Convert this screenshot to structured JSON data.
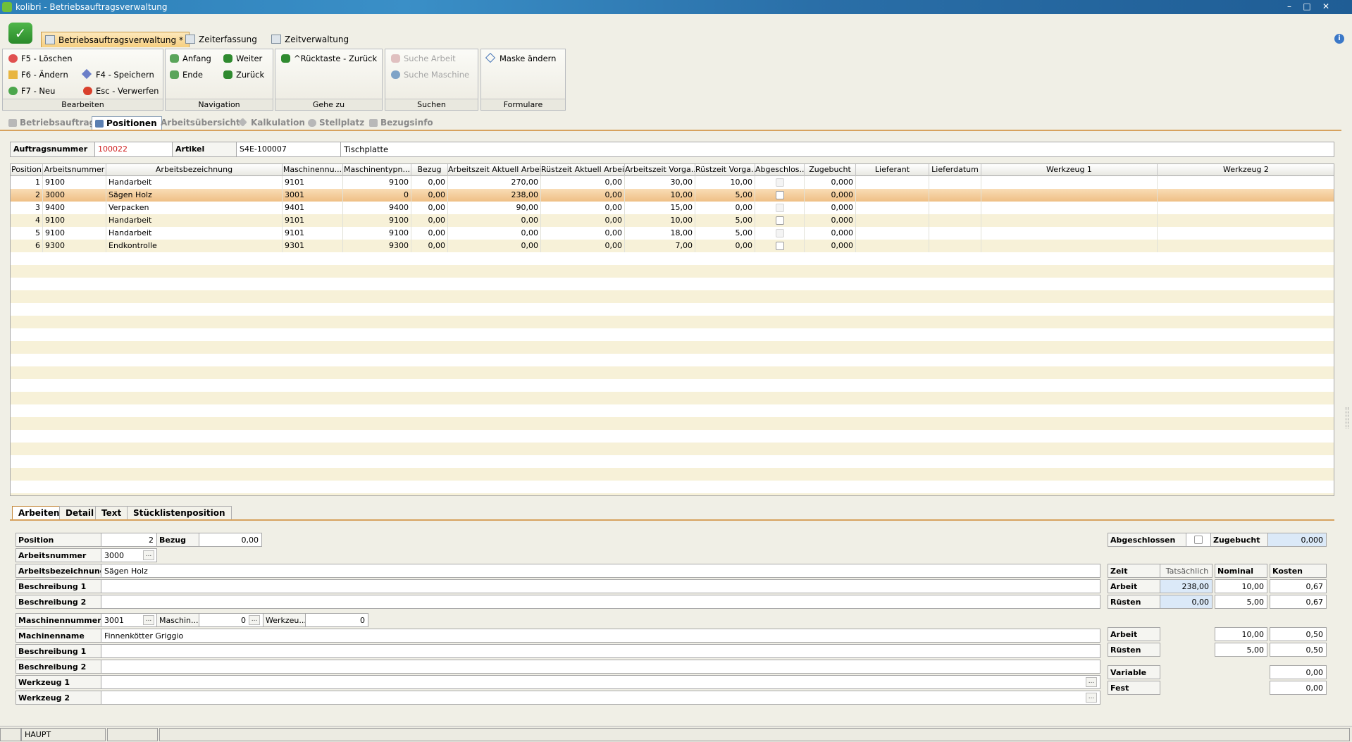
{
  "window": {
    "title": "kolibri - Betriebsauftragsverwaltung"
  },
  "ribbon_tabs": [
    "Betriebsauftragsverwaltung *",
    "Zeiterfassung",
    "Zeitverwaltung"
  ],
  "ribbon": {
    "bearbeiten": {
      "label": "Bearbeiten",
      "loeschen": "F5 - Löschen",
      "aendern": "F6 - Ändern",
      "neu": "F7 - Neu",
      "speichern": "F4 - Speichern",
      "verwerfen": "Esc - Verwerfen"
    },
    "navigation": {
      "label": "Navigation",
      "anfang": "Anfang",
      "weiter": "Weiter",
      "ende": "Ende",
      "zurueck": "Zurück"
    },
    "gehezu": {
      "label": "Gehe zu",
      "ruecktaste": "^Rücktaste - Zurück"
    },
    "suchen": {
      "label": "Suchen",
      "suche_arbeit": "Suche Arbeit",
      "suche_maschine": "Suche Maschine"
    },
    "formulare": {
      "label": "Formulare",
      "maske": "Maske ändern"
    }
  },
  "view_tabs": [
    "Betriebsauftrag",
    "Positionen",
    "Arbeitsübersicht",
    "Kalkulation",
    "Stellplatz",
    "Bezugsinfo"
  ],
  "header": {
    "auftrag_label": "Auftragsnummer",
    "auftrag_value": "100022",
    "artikel_label": "Artikel",
    "artikel_nr": "S4E-100007",
    "artikel_name": "Tischplatte"
  },
  "grid": {
    "columns": [
      "Position",
      "Arbeitsnummer",
      "Arbeitsbezeichnung",
      "Maschinennu...",
      "Maschinentypn...",
      "Bezug",
      "Arbeitszeit Aktuell Arbeit",
      "Rüstzeit Aktuell Arbeit",
      "Arbeitszeit Vorga...",
      "Rüstzeit Vorga...",
      "Abgeschlos...",
      "Zugebucht",
      "Lieferant",
      "Lieferdatum",
      "Werkzeug 1",
      "Werkzeug 2"
    ],
    "rows": [
      [
        "1",
        "9100",
        "Handarbeit",
        "9101",
        "9100",
        "0,00",
        "270,00",
        "0,00",
        "30,00",
        "10,00",
        "",
        "0,000",
        "",
        "",
        "",
        ""
      ],
      [
        "2",
        "3000",
        "Sägen Holz",
        "3001",
        "0",
        "0,00",
        "238,00",
        "0,00",
        "10,00",
        "5,00",
        "",
        "0,000",
        "",
        "",
        "",
        ""
      ],
      [
        "3",
        "9400",
        "Verpacken",
        "9401",
        "9400",
        "0,00",
        "90,00",
        "0,00",
        "15,00",
        "0,00",
        "",
        "0,000",
        "",
        "",
        "",
        ""
      ],
      [
        "4",
        "9100",
        "Handarbeit",
        "9101",
        "9100",
        "0,00",
        "0,00",
        "0,00",
        "10,00",
        "5,00",
        "",
        "0,000",
        "",
        "",
        "",
        ""
      ],
      [
        "5",
        "9100",
        "Handarbeit",
        "9101",
        "9100",
        "0,00",
        "0,00",
        "0,00",
        "18,00",
        "5,00",
        "",
        "0,000",
        "",
        "",
        "",
        ""
      ],
      [
        "6",
        "9300",
        "Endkontrolle",
        "9301",
        "9300",
        "0,00",
        "0,00",
        "0,00",
        "7,00",
        "0,00",
        "",
        "0,000",
        "",
        "",
        "",
        ""
      ]
    ]
  },
  "lower_tabs": [
    "Arbeiten",
    "Detail",
    "Text",
    "Stücklistenposition"
  ],
  "detail": {
    "position_label": "Position",
    "position_value": "2",
    "bezug_label": "Bezug",
    "bezug_value": "0,00",
    "arbeitsnummer_label": "Arbeitsnummer",
    "arbeitsnummer_value": "3000",
    "arbeitsbez_label": "Arbeitsbezeichnung",
    "arbeitsbez_value": "Sägen Holz",
    "beschr1_label": "Beschreibung 1",
    "beschr2_label": "Beschreibung 2",
    "maschnr_label": "Maschinennummer",
    "maschnr_value": "3001",
    "maschin_label": "Maschin...",
    "maschin_value": "0",
    "werkzeu_label": "Werkzeu...",
    "werkzeu_value": "0",
    "maschname_label": "Machinenname",
    "maschname_value": "Finnenkötter Griggio",
    "m_beschr1_label": "Beschreibung 1",
    "m_beschr2_label": "Beschreibung 2",
    "werkzeug1_label": "Werkzeug 1",
    "werkzeug2_label": "Werkzeug 2"
  },
  "summary": {
    "abgeschlossen_label": "Abgeschlossen",
    "zugebucht_label": "Zugebucht",
    "zugebucht_value": "0,000",
    "col_zeit": "Zeit",
    "col_tats": "Tatsächlich",
    "col_nominal": "Nominal",
    "col_kosten": "Kosten",
    "arbeit_label": "Arbeit",
    "arbeit_tats": "238,00",
    "arbeit_nominal": "10,00",
    "arbeit_kosten": "0,67",
    "ruesten_label": "Rüsten",
    "ruesten_tats": "0,00",
    "ruesten_nominal": "5,00",
    "ruesten_kosten": "0,67",
    "arbeit2_label": "Arbeit",
    "arbeit2_nominal": "10,00",
    "arbeit2_kosten": "0,50",
    "ruesten2_label": "Rüsten",
    "ruesten2_nominal": "5,00",
    "ruesten2_kosten": "0,50",
    "variable_label": "Variable",
    "variable_value": "0,00",
    "fest_label": "Fest",
    "fest_value": "0,00"
  },
  "status": {
    "mode": "HAUPT"
  }
}
